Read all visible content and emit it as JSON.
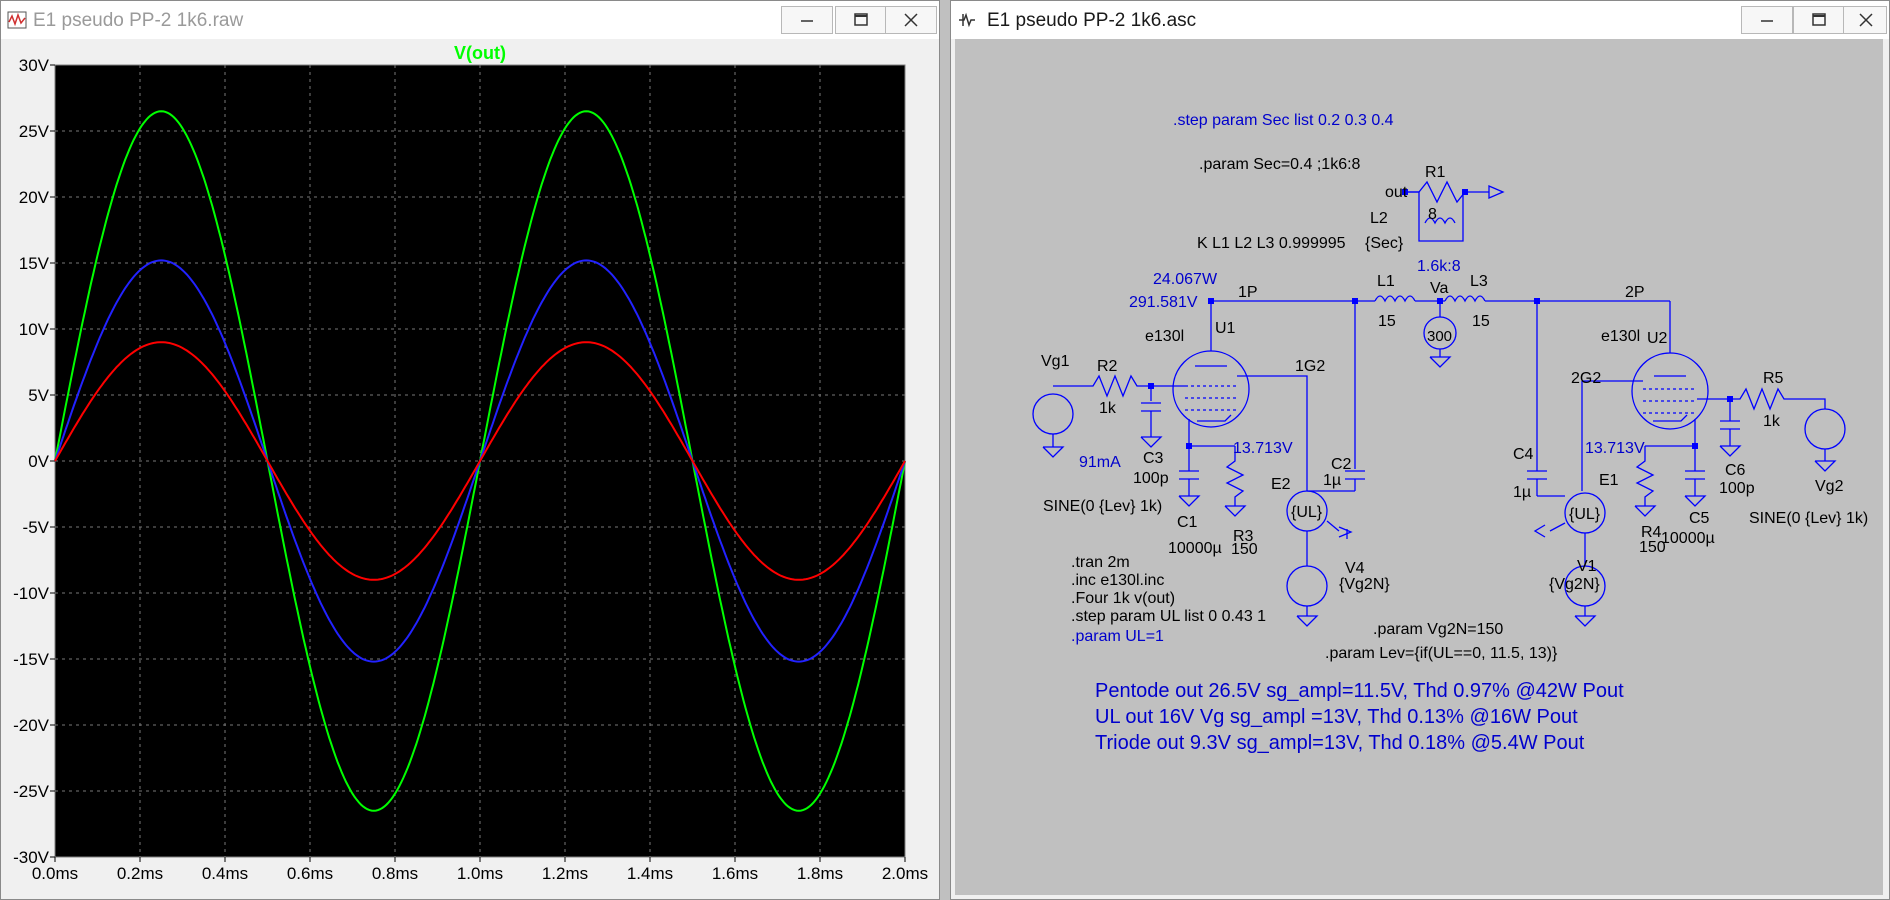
{
  "plot_window": {
    "title": "E1 pseudo PP-2 1k6.raw",
    "icon": "waveform-icon",
    "buttons": {
      "minimize": "minimize-icon",
      "maximize": "maximize-icon",
      "close": "close-icon"
    }
  },
  "schematic_window": {
    "title": "E1 pseudo PP-2 1k6.asc",
    "icon": "schematic-icon",
    "buttons": {
      "minimize": "minimize-icon",
      "maximize": "maximize-icon",
      "close": "close-icon"
    }
  },
  "chart_data": {
    "type": "line",
    "title": "V(out)",
    "xlabel": "",
    "ylabel": "",
    "xlim": [
      0,
      2.0
    ],
    "ylim": [
      -30,
      30
    ],
    "x_unit": "ms",
    "y_unit": "V",
    "x_ticks": [
      "0.0ms",
      "0.2ms",
      "0.4ms",
      "0.6ms",
      "0.8ms",
      "1.0ms",
      "1.2ms",
      "1.4ms",
      "1.6ms",
      "1.8ms",
      "2.0ms"
    ],
    "y_ticks": [
      "30V",
      "25V",
      "20V",
      "15V",
      "10V",
      "5V",
      "0V",
      "-5V",
      "-10V",
      "-15V",
      "-20V",
      "-25V",
      "-30V"
    ],
    "grid": true,
    "background": "#000000",
    "title_color": "#00ff00",
    "series": [
      {
        "color": "#00ff00",
        "amplitude": 26.5,
        "frequency_khz": 1
      },
      {
        "color": "#2222ff",
        "amplitude": 15.2,
        "frequency_khz": 1
      },
      {
        "color": "#ff0000",
        "amplitude": 9.0,
        "frequency_khz": 1
      }
    ]
  },
  "schematic": {
    "directives": {
      "step_sec": ".step param Sec list 0.2 0.3 0.4",
      "param_sec": ".param Sec=0.4 ;1k6:8",
      "coupling": "K L1 L2  L3 0.999995",
      "tran": ".tran 2m",
      "inc": ".inc e130l.inc",
      "four": ".Four 1k v(out)",
      "step_ul": ".step param UL list 0 0.43 1",
      "param_ul": ".param UL=1",
      "param_vg2n": ".param Vg2N=150",
      "param_lev": ".param Lev={if(UL==0, 11.5, 13)}"
    },
    "notes": [
      "Pentode out 26.5V sg_ampl=11.5V, Thd 0.97% @42W Pout",
      "UL out 16V Vg sg_ampl =13V, Thd 0.13% @16W Pout",
      "Triode out 9.3V sg_ampl=13V, Thd 0.18% @5.4W Pout"
    ],
    "labels": {
      "out": "out",
      "r1": "R1",
      "r1_val": "8",
      "l2": "L2",
      "l2_val": "{Sec}",
      "ratio": "1.6k:8",
      "power": "24.067W",
      "volt_1p": "291.581V",
      "net_1p": "1P",
      "l1": "L1",
      "l1_val": "15",
      "va": "Va",
      "l3": "L3",
      "l3_val": "15",
      "net_2p": "2P",
      "supply_val": "300",
      "u1_model": "e130l",
      "u1": "U1",
      "net_1g2": "1G2",
      "u2_model": "e130l",
      "u2": "U2",
      "net_2g2": "2G2",
      "vg1": "Vg1",
      "r2": "R2",
      "r2_val": "1k",
      "c3": "C3",
      "c3_val": "100p",
      "current": "91mA",
      "vk1": "13.713V",
      "vk2": "13.713V",
      "c2": "C2",
      "c2_val": "1µ",
      "e2": "E2",
      "e2_val": "{UL}",
      "sine1": "SINE(0 {Lev} 1k)",
      "c1": "C1",
      "c1_val": "10000µ",
      "r3": "R3",
      "r3_val": "150",
      "v4": "V4",
      "v4_val": "{Vg2N}",
      "c4": "C4",
      "c4_val": "1µ",
      "e1": "E1",
      "e1_val": "{UL}",
      "r4": "R4",
      "r4_val": "150",
      "c5": "C5",
      "c5_val": "10000µ",
      "c6": "C6",
      "c6_val": "100p",
      "r5": "R5",
      "r5_val": "1k",
      "vg2": "Vg2",
      "sine2": "SINE(0 {Lev} 1k)",
      "v1": "V1",
      "v1_val": "{Vg2N}"
    },
    "colors": {
      "wire": "#0000ff",
      "text": "#000000",
      "directive": "#0000cc",
      "background": "#c0c0c0"
    }
  }
}
